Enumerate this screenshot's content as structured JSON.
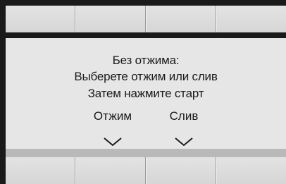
{
  "screen": {
    "line1": "Без отжима:",
    "line2": "Выберете отжим или слив",
    "line3": "Затем нажмите старт"
  },
  "options": [
    {
      "label": "Отжим",
      "icon": "chevron-down-icon"
    },
    {
      "label": "Слив",
      "icon": "chevron-down-icon"
    }
  ],
  "colors": {
    "screen_bg": "#e6e6e6",
    "bezel": "#1a1a1a",
    "button": "#d9d9d9",
    "footer_strip": "#b9b9b9"
  }
}
